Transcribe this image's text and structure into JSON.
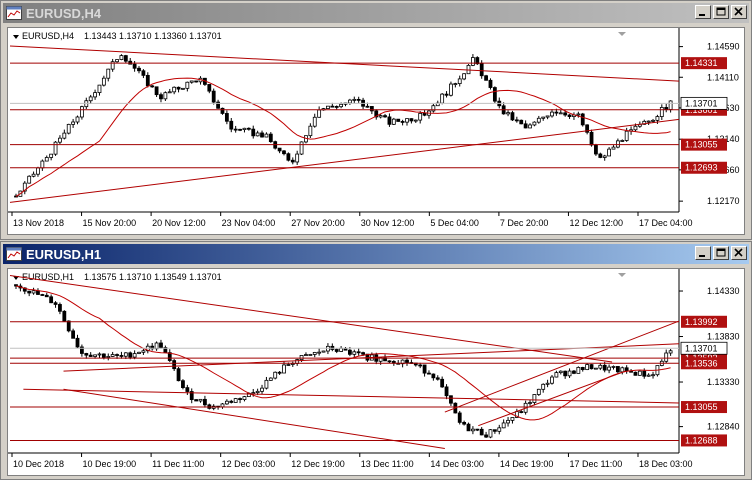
{
  "windows": [
    {
      "id": "h4",
      "title": "EURUSD,H4",
      "active": false,
      "info_symbol": "EURUSD,H4",
      "info_ohlc": "1.13443 1.13710 1.13360 1.13701",
      "price_axis": [
        {
          "label": "1.14590",
          "value": 1.1459
        },
        {
          "label": "1.14110",
          "value": 1.1411
        },
        {
          "label": "1.13630",
          "value": 1.1363
        },
        {
          "label": "1.13140",
          "value": 1.1314
        },
        {
          "label": "1.12660",
          "value": 1.1266
        },
        {
          "label": "1.12170",
          "value": 1.1217
        }
      ],
      "price_range": [
        1.12,
        1.1485
      ],
      "levels": [
        {
          "label": "1.14331",
          "value": 1.14331
        },
        {
          "label": "1.13601",
          "value": 1.13601
        },
        {
          "label": "1.13055",
          "value": 1.13055
        },
        {
          "label": "1.12693",
          "value": 1.12693
        }
      ],
      "current_price": {
        "label": "1.13701",
        "value": 1.13701
      },
      "time_axis": [
        "13 Nov 2018",
        "15 Nov 20:00",
        "20 Nov 12:00",
        "23 Nov 04:00",
        "27 Nov 20:00",
        "30 Nov 12:00",
        "5 Dec 04:00",
        "7 Dec 20:00",
        "12 Dec 12:00",
        "17 Dec 04:00"
      ],
      "colors": {
        "candle": "#000000",
        "level": "#a00000",
        "trend": "#b00000",
        "ma": "#c00000",
        "label_bg": "#b01010"
      }
    },
    {
      "id": "h1",
      "title": "EURUSD,H1",
      "active": true,
      "info_symbol": "EURUSD,H1",
      "info_ohlc": "1.13575 1.13710 1.13549 1.13701",
      "price_axis": [
        {
          "label": "1.14330",
          "value": 1.1433
        },
        {
          "label": "1.13830",
          "value": 1.1383
        },
        {
          "label": "1.13330",
          "value": 1.1333
        },
        {
          "label": "1.12840",
          "value": 1.1284
        }
      ],
      "price_range": [
        1.1255,
        1.1455
      ],
      "levels": [
        {
          "label": "1.13992",
          "value": 1.13992
        },
        {
          "label": "1.13592",
          "value": 1.13592
        },
        {
          "label": "1.13536",
          "value": 1.13536
        },
        {
          "label": "1.13055",
          "value": 1.13055
        },
        {
          "label": "1.12688",
          "value": 1.12688
        }
      ],
      "current_price": {
        "label": "1.13701",
        "value": 1.13701
      },
      "time_axis": [
        "10 Dec 2018",
        "10 Dec 19:00",
        "11 Dec 11:00",
        "12 Dec 03:00",
        "12 Dec 19:00",
        "13 Dec 11:00",
        "14 Dec 03:00",
        "14 Dec 19:00",
        "17 Dec 11:00",
        "18 Dec 03:00"
      ],
      "colors": {
        "candle": "#000000",
        "level": "#a00000",
        "trend": "#b00000",
        "ma": "#c00000",
        "label_bg": "#b01010"
      }
    }
  ]
}
